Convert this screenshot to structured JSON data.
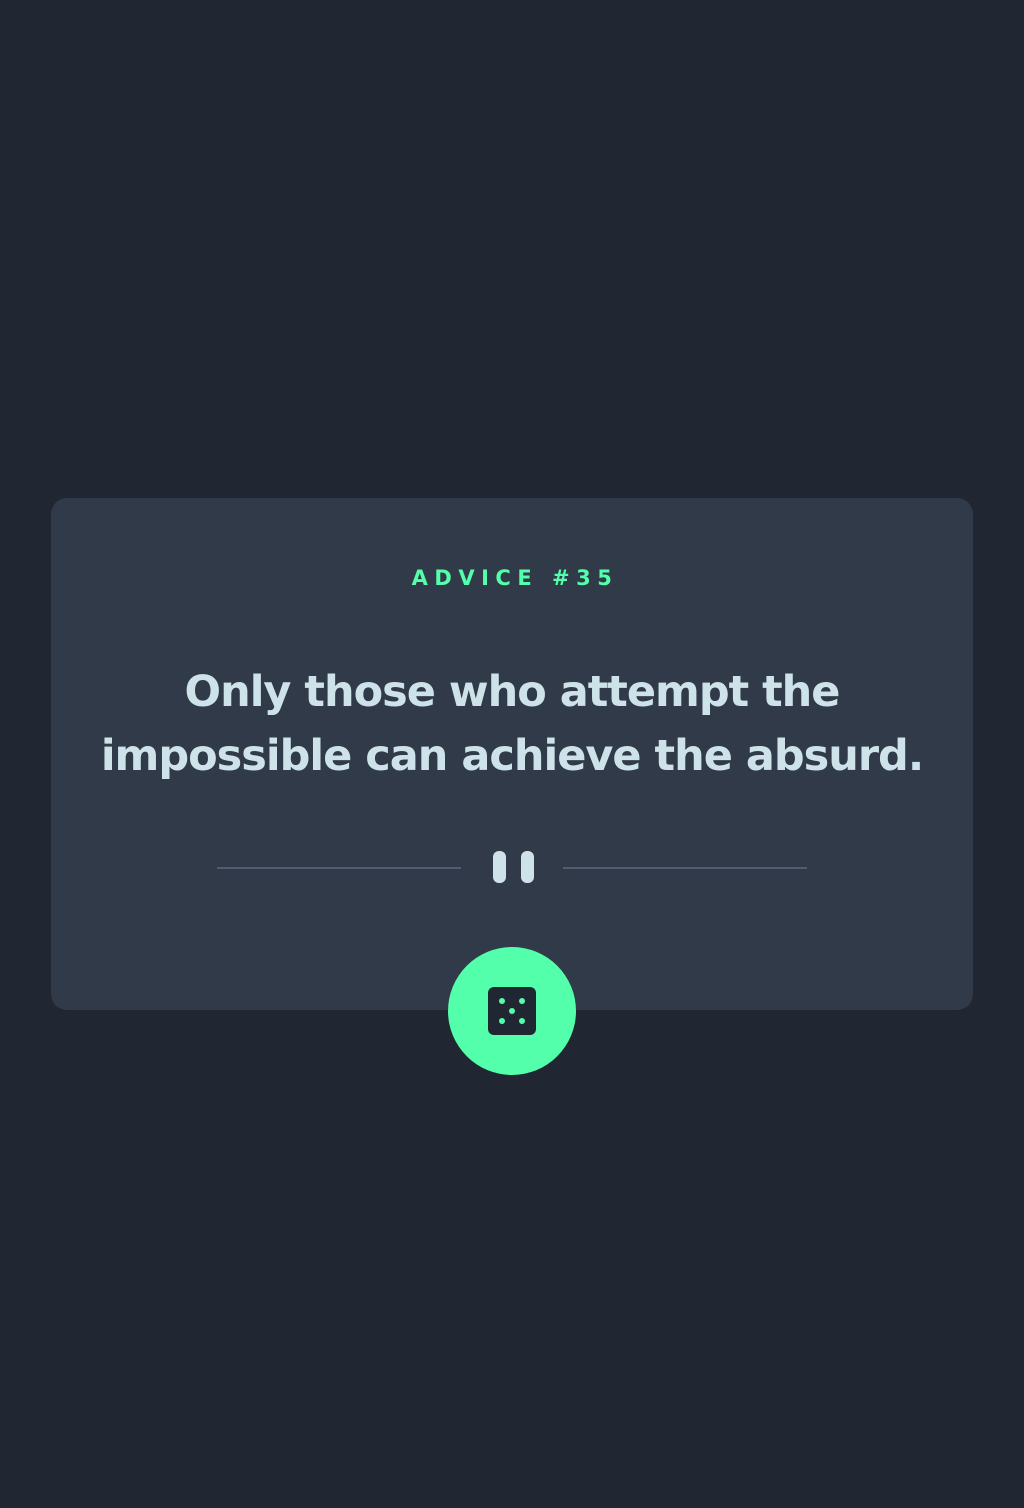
{
  "advice": {
    "label": "ADVICE #35",
    "quote": "Only those who attempt the impossible can achieve the absurd."
  },
  "divider": {
    "icon": "pause-icon"
  },
  "dice_button": {
    "icon": "dice-icon"
  },
  "colors": {
    "background": "#202632",
    "card": "#313A48",
    "accent": "#53FFAA",
    "text": "#CEE3E9",
    "divider": "#4F5D74"
  }
}
